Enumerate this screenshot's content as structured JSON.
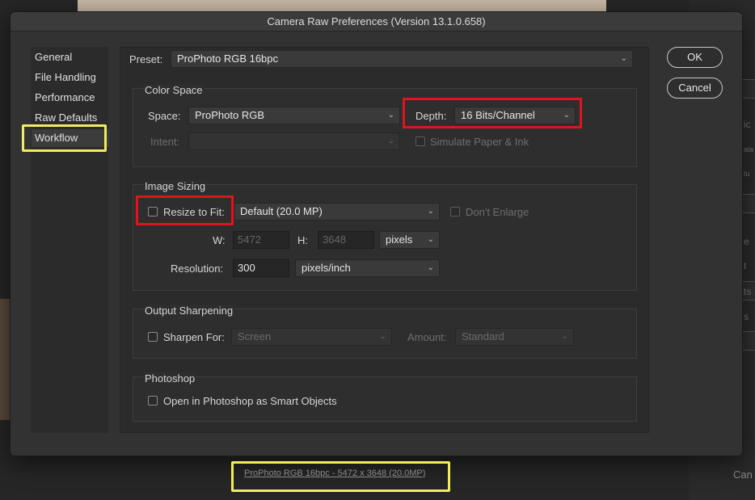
{
  "dialog": {
    "title": "Camera Raw Preferences  (Version 13.1.0.658)"
  },
  "sidebar": {
    "items": [
      {
        "label": "General"
      },
      {
        "label": "File Handling"
      },
      {
        "label": "Performance"
      },
      {
        "label": "Raw Defaults"
      },
      {
        "label": "Workflow",
        "selected": true
      }
    ]
  },
  "preset": {
    "label": "Preset:",
    "value": "ProPhoto RGB 16bpc"
  },
  "color_space": {
    "title": "Color Space",
    "space_label": "Space:",
    "space_value": "ProPhoto RGB",
    "depth_label": "Depth:",
    "depth_value": "16 Bits/Channel",
    "intent_label": "Intent:",
    "intent_value": "",
    "simulate_label": "Simulate Paper & Ink"
  },
  "image_sizing": {
    "title": "Image Sizing",
    "resize_label": "Resize to Fit:",
    "resize_value": "Default  (20.0 MP)",
    "dont_enlarge_label": "Don't Enlarge",
    "w_label": "W:",
    "w_value": "5472",
    "h_label": "H:",
    "h_value": "3648",
    "units_value": "pixels",
    "resolution_label": "Resolution:",
    "resolution_value": "300",
    "resolution_units": "pixels/inch"
  },
  "output_sharpening": {
    "title": "Output Sharpening",
    "sharpen_label": "Sharpen For:",
    "sharpen_value": "Screen",
    "amount_label": "Amount:",
    "amount_value": "Standard"
  },
  "photoshop": {
    "title": "Photoshop",
    "smart_objects_label": "Open in Photoshop as Smart Objects"
  },
  "buttons": {
    "ok": "OK",
    "cancel": "Cancel"
  },
  "status_link": "ProPhoto RGB 16bpc - 5472 x 3648 (20.0MP)",
  "background": {
    "cancel_text": "Can",
    "right_snippets": [
      "ic",
      "ala",
      "tu",
      "e",
      "t",
      "ts",
      "s"
    ]
  },
  "colors": {
    "highlight_yellow": "#f2eb5e",
    "highlight_red": "#e0141e"
  }
}
